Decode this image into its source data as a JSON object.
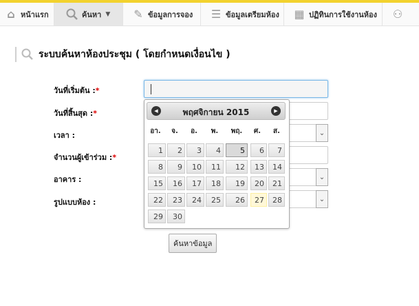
{
  "nav": {
    "items": [
      {
        "label": "หน้าแรก",
        "icon": "home-icon"
      },
      {
        "label": "ค้นหา",
        "icon": "search-icon"
      },
      {
        "label": "ข้อมูลการจอง",
        "icon": "booking-icon"
      },
      {
        "label": "ข้อมูลเตรียมห้อง",
        "icon": "list-icon"
      },
      {
        "label": "ปฏิทินการใช้งานห้อง",
        "icon": "calendar-icon"
      },
      {
        "label": "",
        "icon": "people-icon"
      }
    ]
  },
  "page": {
    "title": "ระบบค้นหาห้องประชุม ( โดยกำหนดเงื่อนไข )"
  },
  "form": {
    "start_date_label": "วันที่เริ่มต้น :",
    "end_date_label": "วันที่สิ้นสุด :",
    "time_label": "เวลา :",
    "attendees_label": "จำนวนผู้เข้าร่วม :",
    "building_label": "อาคาร :",
    "room_type_label": "รูปแบบห้อง :",
    "required_mark": "*",
    "search_button": "ค้นหาข้อมูล"
  },
  "calendar": {
    "month_year": "พฤศจิกายน 2015",
    "weekdays": [
      "อา.",
      "จ.",
      "อ.",
      "พ.",
      "พฤ.",
      "ศ.",
      "ส."
    ],
    "weeks": [
      [
        "1",
        "2",
        "3",
        "4",
        "5",
        "6",
        "7"
      ],
      [
        "8",
        "9",
        "10",
        "11",
        "12",
        "13",
        "14"
      ],
      [
        "15",
        "16",
        "17",
        "18",
        "19",
        "20",
        "21"
      ],
      [
        "22",
        "23",
        "24",
        "25",
        "26",
        "27",
        "28"
      ],
      [
        "29",
        "30"
      ]
    ],
    "active_day": "5",
    "today": "27"
  },
  "colors": {
    "accent_line": "#f2d22e",
    "required": "#dd0000",
    "focus_border": "#79b7e7"
  }
}
